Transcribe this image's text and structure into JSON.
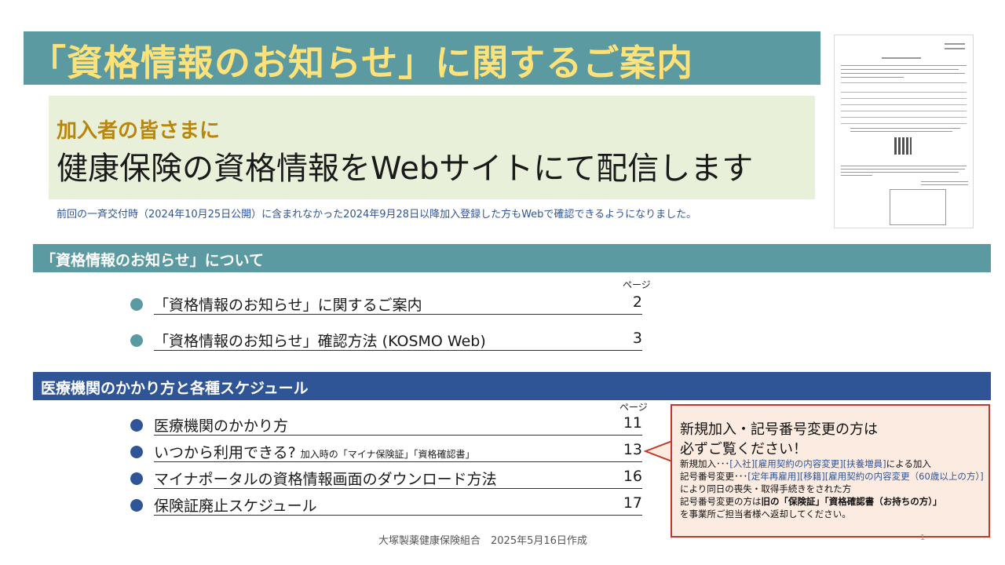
{
  "title": "「資格情報のお知らせ」に関するご案内",
  "banner": {
    "subtitle": "加入者の皆さまに",
    "headline": "健康保険の資格情報をWebサイトにて配信します"
  },
  "note": "前回の一斉交付時（2024年10月25日公開）に含まれなかった2024年9月28日以降加入登録した方もWebで確認できるようになりました。",
  "section1": {
    "label": "「資格情報のお知らせ」について",
    "page_header": "ページ",
    "items": [
      {
        "label": "「資格情報のお知らせ」に関するご案内",
        "page": "2"
      },
      {
        "label": "「資格情報のお知らせ」確認方法 (KOSMO Web)",
        "page": "3"
      }
    ]
  },
  "section2": {
    "label": "医療機関のかかり方と各種スケジュール",
    "page_header": "ページ",
    "items": [
      {
        "label": "医療機関のかかり方",
        "small": "",
        "page": "11"
      },
      {
        "label": "いつから利用できる? ",
        "small": "加入時の「マイナ保険証」「資格確認書」",
        "page": "13"
      },
      {
        "label": "マイナポータルの資格情報画面のダウンロード方法",
        "small": "",
        "page": "16"
      },
      {
        "label": "保険証廃止スケジュール",
        "small": "",
        "page": "17"
      }
    ]
  },
  "callout": {
    "heading_1": "新規加入・記号番号変更の方は",
    "heading_2": "必ずご覧ください！",
    "line1_prefix": "新規加入･･･",
    "line1_tags": "[入社][雇用契約の内容変更][扶養増員]",
    "line1_suffix": "による加入",
    "line2_prefix": "記号番号変更･･･",
    "line2_tags": "[定年再雇用][移籍][雇用契約の内容変更（60歳以上の方）]",
    "line2_suffix": "により同日の喪失・取得手続きをされた方",
    "line3_prefix": "記号番号変更の方は",
    "line3_bold": "旧の「保険証」「資格確認書（お持ちの方）」",
    "line4": "を事業所ご担当者様へ返却してください。"
  },
  "footer": "大塚製薬健康保険組合　2025年5月16日作成",
  "slide_number": "1",
  "colors": {
    "teal": "#5b9aa0",
    "navy": "#2f5597",
    "title_yellow": "#fde27a",
    "gold": "#b8860b",
    "banner_bg": "#e9f0da",
    "callout_border": "#c0392b",
    "callout_bg": "#fcebe0"
  }
}
